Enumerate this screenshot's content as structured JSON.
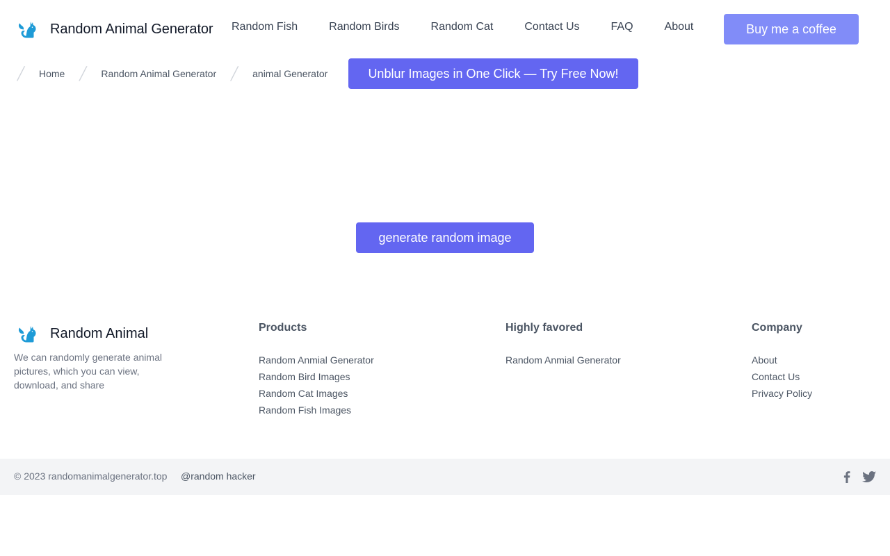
{
  "header": {
    "brand_name": "Random Animal Generator",
    "nav": [
      {
        "label": "Random Fish"
      },
      {
        "label": "Random Birds"
      },
      {
        "label": "Random Cat"
      },
      {
        "label": "Contact Us"
      },
      {
        "label": "FAQ"
      },
      {
        "label": "About"
      }
    ],
    "coffee_label": "Buy me a coffee"
  },
  "breadcrumb": {
    "items": [
      {
        "label": "Home"
      },
      {
        "label": "Random Animal Generator"
      },
      {
        "label": "animal Generator"
      }
    ]
  },
  "promo": {
    "unblur_label": "Unblur Images in One Click — Try Free Now!"
  },
  "main": {
    "generate_label": "generate random image"
  },
  "footer": {
    "brand_name": "Random Animal",
    "description": "We can randomly generate animal pictures, which you can view, download, and share",
    "columns": {
      "products": {
        "title": "Products",
        "links": [
          "Random Anmial Generator",
          "Random Bird Images",
          "Random Cat Images",
          "Random Fish Images"
        ]
      },
      "favored": {
        "title": "Highly favored",
        "links": [
          "Random Anmial Generator"
        ]
      },
      "company": {
        "title": "Company",
        "links": [
          "About",
          "Contact Us",
          "Privacy Policy"
        ]
      }
    },
    "copyright": "© 2023 randomanimalgenerator.top",
    "handle": "@random hacker",
    "social_icons": [
      "facebook-icon",
      "twitter-icon"
    ]
  },
  "colors": {
    "accent": "#6366f1",
    "accent_light": "#818cf8",
    "logo_blue": "#1e9bd7",
    "footer_bar": "#f3f4f6"
  }
}
